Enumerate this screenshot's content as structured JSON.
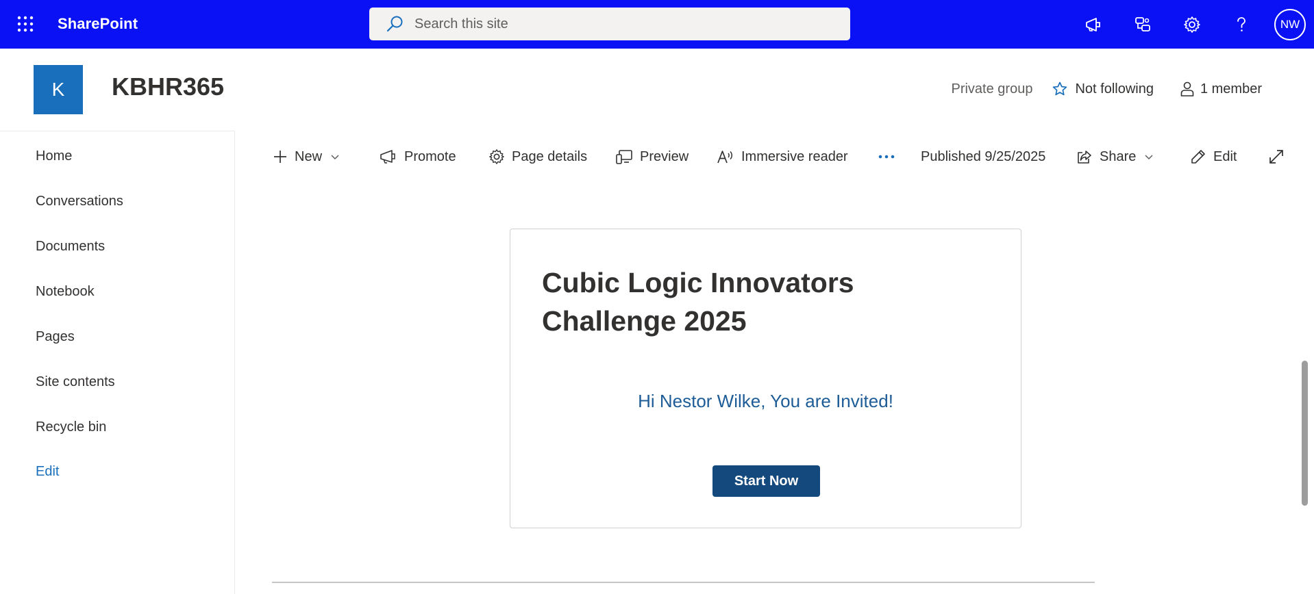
{
  "suite": {
    "app_name": "SharePoint",
    "search_placeholder": "Search this site",
    "avatar_initials": "NW",
    "bar_color": "#0a12f5"
  },
  "site": {
    "logo_letter": "K",
    "title": "KBHR365",
    "privacy": "Private group",
    "follow_label": "Not following",
    "members_label": "1 member"
  },
  "nav": {
    "items": [
      "Home",
      "Conversations",
      "Documents",
      "Notebook",
      "Pages",
      "Site contents",
      "Recycle bin"
    ],
    "edit_label": "Edit"
  },
  "commandbar": {
    "new_label": "New",
    "promote_label": "Promote",
    "page_details_label": "Page details",
    "preview_label": "Preview",
    "immersive_reader_label": "Immersive reader",
    "published_label": "Published 9/25/2025",
    "share_label": "Share",
    "edit_label": "Edit"
  },
  "content": {
    "title": "Cubic Logic Innovators Challenge 2025",
    "invite_text": "Hi Nestor Wilke, You are Invited!",
    "start_button": "Start Now"
  }
}
